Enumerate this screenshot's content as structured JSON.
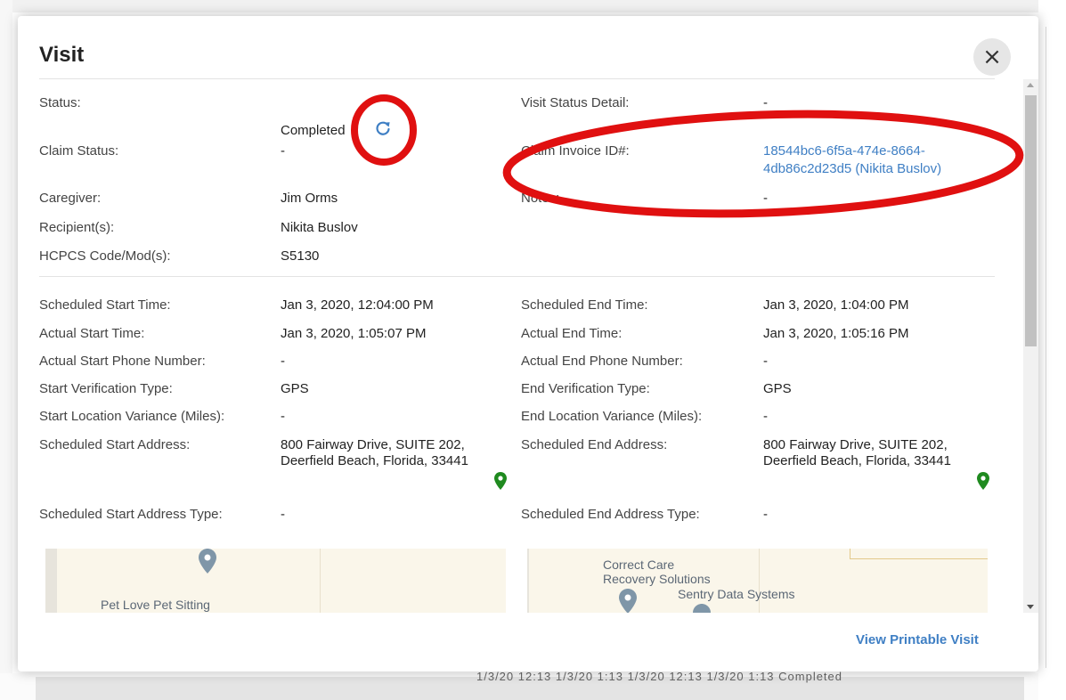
{
  "modal": {
    "title": "Visit",
    "close_glyph": "×",
    "view_printable_label": "View Printable Visit"
  },
  "background": {
    "partial_row_text": "1/3/20 12:13   1/3/20 1:13   1/3/20 12:13   1/3/20 1:13   Completed"
  },
  "summary": {
    "status_label": "Status:",
    "status_value": "Completed",
    "visit_status_detail_label": "Visit Status Detail:",
    "visit_status_detail_value": "-",
    "claim_status_label": "Claim Status:",
    "claim_status_value": "-",
    "claim_invoice_label": "Claim Invoice ID#:",
    "claim_invoice_line1": "18544bc6-6f5a-474e-8664-",
    "claim_invoice_line2": "4db86c2d23d5 (Nikita Buslov)",
    "caregiver_label": "Caregiver:",
    "caregiver_value": "Jim Orms",
    "notes_label": "Notes:",
    "notes_value": "-",
    "recipients_label": "Recipient(s):",
    "recipients_value": "Nikita Buslov",
    "hcpcs_label": "HCPCS Code/Mod(s):",
    "hcpcs_value": "S5130"
  },
  "times": {
    "scheduled_start_label": "Scheduled Start Time:",
    "scheduled_start_value": "Jan 3, 2020, 12:04:00 PM",
    "scheduled_end_label": "Scheduled End Time:",
    "scheduled_end_value": "Jan 3, 2020, 1:04:00 PM",
    "actual_start_label": "Actual Start Time:",
    "actual_start_value": "Jan 3, 2020, 1:05:07 PM",
    "actual_end_label": "Actual End Time:",
    "actual_end_value": "Jan 3, 2020, 1:05:16 PM",
    "actual_start_phone_label": "Actual Start Phone Number:",
    "actual_start_phone_value": "-",
    "actual_end_phone_label": "Actual End Phone Number:",
    "actual_end_phone_value": "-",
    "start_verification_label": "Start Verification Type:",
    "start_verification_value": "GPS",
    "end_verification_label": "End Verification Type:",
    "end_verification_value": "GPS",
    "start_variance_label": "Start Location Variance (Miles):",
    "start_variance_value": "-",
    "end_variance_label": "End Location Variance (Miles):",
    "end_variance_value": "-",
    "scheduled_start_address_label": "Scheduled Start Address:",
    "scheduled_start_address_value": "800 Fairway Drive, SUITE 202, Deerfield Beach, Florida, 33441",
    "scheduled_end_address_label": "Scheduled End Address:",
    "scheduled_end_address_value": "800 Fairway Drive, SUITE 202, Deerfield Beach, Florida, 33441",
    "scheduled_start_address_type_label": "Scheduled Start Address Type:",
    "scheduled_start_address_type_value": "-",
    "scheduled_end_address_type_label": "Scheduled End Address Type:",
    "scheduled_end_address_type_value": "-"
  },
  "maps": {
    "start_place": "Pet Love Pet Sitting",
    "end_place_1_line1": "Correct Care",
    "end_place_1_line2": "Recovery Solutions",
    "end_place_2": "Sentry Data Systems"
  },
  "icons": {
    "refresh": "refresh-icon",
    "close": "close-icon",
    "location_pin": "location-pin-icon",
    "map_marker": "map-marker-icon"
  },
  "colors": {
    "link": "#3f7fc4",
    "pin_green": "#1f8a1f",
    "map_marker": "#7f96a8",
    "annotation_red": "#e01010"
  }
}
